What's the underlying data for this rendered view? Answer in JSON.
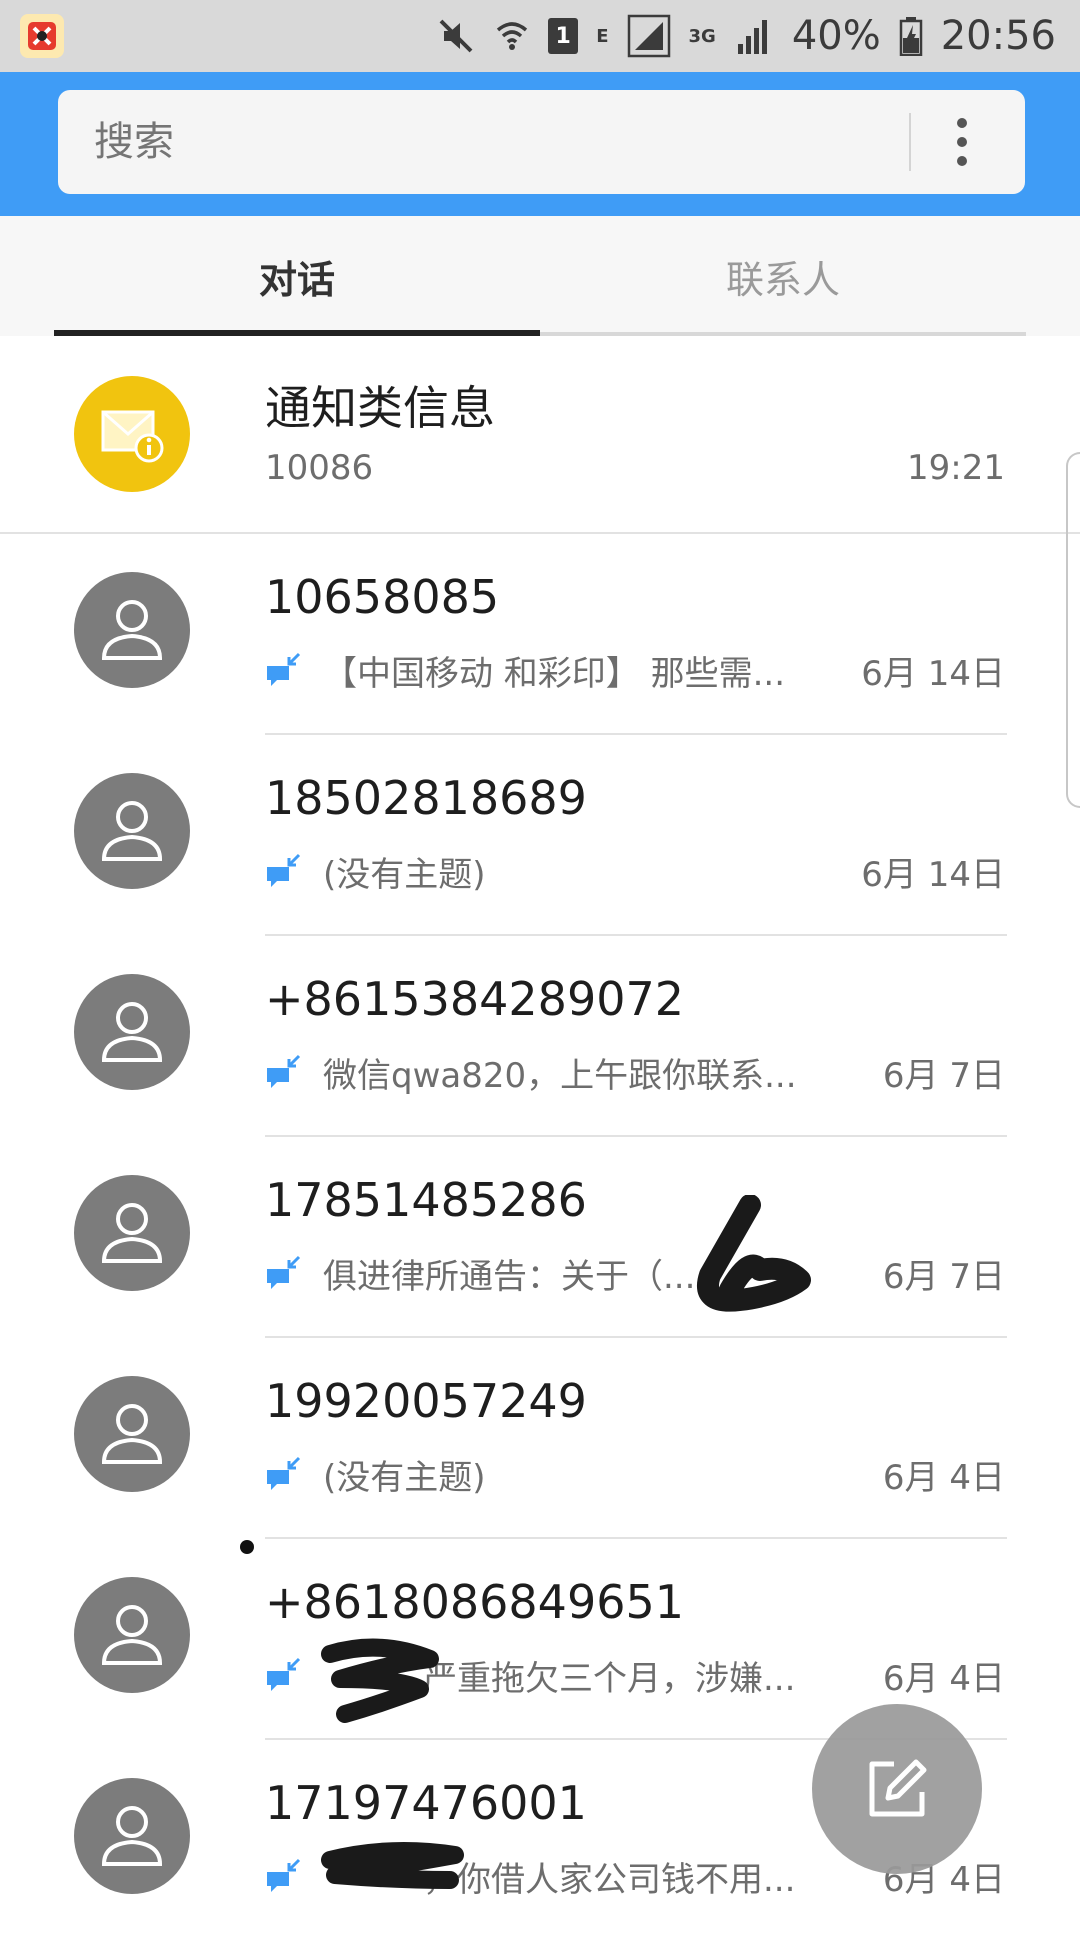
{
  "status_bar": {
    "battery": "40%",
    "time": "20:56",
    "sim_badge": "1",
    "network_e": "E",
    "network_3g": "3G"
  },
  "search": {
    "placeholder": "搜索"
  },
  "tabs": [
    {
      "label": "对话",
      "active": true
    },
    {
      "label": "联系人",
      "active": false
    }
  ],
  "conversations": [
    {
      "title": "通知类信息",
      "preview": "10086",
      "time": "19:21"
    },
    {
      "title": "10658085",
      "preview": "【中国移动 和彩印】 那些需...",
      "time": "6月 14日"
    },
    {
      "title": "18502818689",
      "preview": "(没有主题)",
      "time": "6月 14日"
    },
    {
      "title": "+8615384289072",
      "preview": "微信qwa820，上午跟你联系...",
      "time": "6月 7日"
    },
    {
      "title": "17851485286",
      "preview": "俱进律所通告：关于（...",
      "time": "6月 7日"
    },
    {
      "title": "19920057249",
      "preview": "(没有主题)",
      "time": "6月 4日"
    },
    {
      "title": "+8618086849651",
      "preview": "严重拖欠三个月，涉嫌...",
      "time": "6月 4日"
    },
    {
      "title": "17197476001",
      "preview": "，你借人家公司钱不用...",
      "time": "6月 4日"
    }
  ],
  "colors": {
    "header_blue": "#3f9cf6",
    "notice_yellow": "#f1c40f",
    "avatar_gray": "#7c7c7c",
    "message_icon_blue": "#3f9cf6"
  }
}
